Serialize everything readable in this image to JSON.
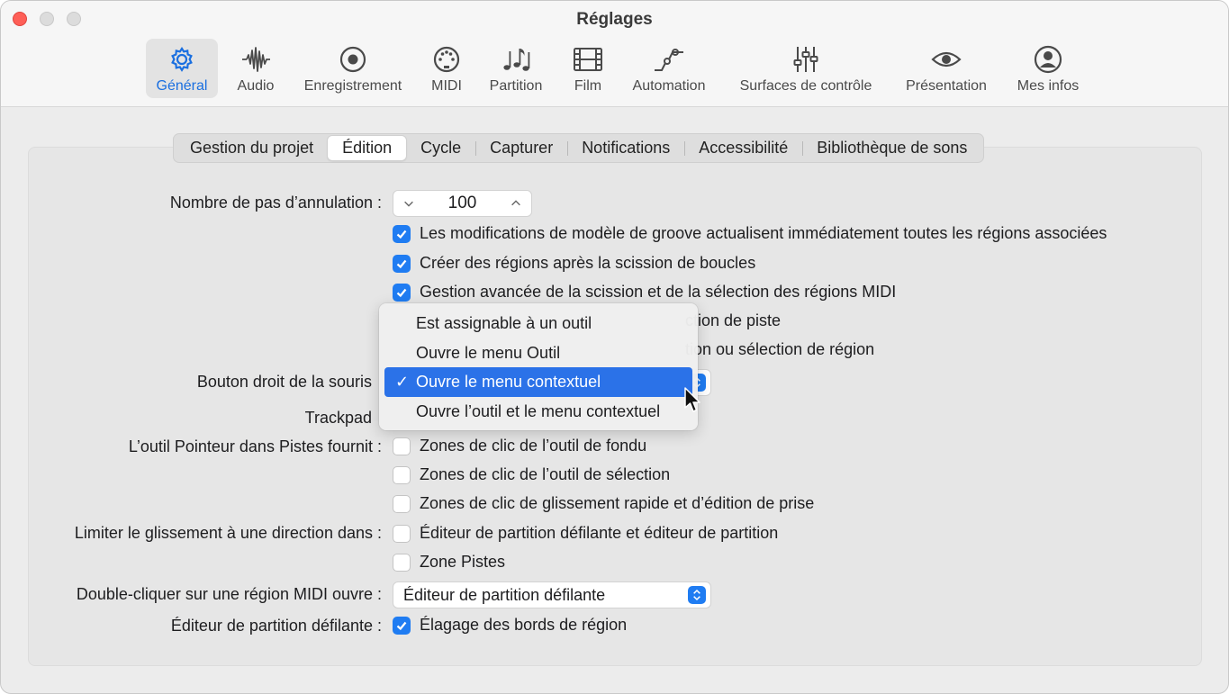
{
  "window": {
    "title": "Réglages"
  },
  "toolbar": {
    "items": [
      {
        "label": "Général",
        "icon": "gear-icon",
        "active": true
      },
      {
        "label": "Audio",
        "icon": "waveform-icon"
      },
      {
        "label": "Enregistrement",
        "icon": "record-icon"
      },
      {
        "label": "MIDI",
        "icon": "midi-port-icon"
      },
      {
        "label": "Partition",
        "icon": "music-notes-icon"
      },
      {
        "label": "Film",
        "icon": "film-icon"
      },
      {
        "label": "Automation",
        "icon": "automation-curve-icon"
      },
      {
        "label": "Surfaces de contrôle",
        "icon": "sliders-icon"
      },
      {
        "label": "Présentation",
        "icon": "eye-icon"
      },
      {
        "label": "Mes infos",
        "icon": "person-icon"
      }
    ]
  },
  "tabs": {
    "items": [
      {
        "label": "Gestion du projet"
      },
      {
        "label": "Édition",
        "active": true
      },
      {
        "label": "Cycle"
      },
      {
        "label": "Capturer"
      },
      {
        "label": "Notifications"
      },
      {
        "label": "Accessibilité"
      },
      {
        "label": "Bibliothèque de sons"
      }
    ]
  },
  "settings": {
    "undo_steps": {
      "label": "Nombre de pas d’annulation :",
      "value": "100"
    },
    "checkboxes_top": [
      {
        "label": "Les modifications de modèle de groove actualisent immédiatement toutes les régions associées",
        "checked": true
      },
      {
        "label": "Créer des régions après la scission de boucles",
        "checked": true
      },
      {
        "label": "Gestion avancée de la scission et de la sélection des régions MIDI",
        "checked": true
      }
    ],
    "partial_rows": [
      {
        "text": "ction de piste"
      },
      {
        "text": "tion ou sélection de région"
      }
    ],
    "right_mouse": {
      "label": "Bouton droit de la souris"
    },
    "trackpad": {
      "label": "Trackpad"
    },
    "context_menu": {
      "items": [
        {
          "label": "Est assignable à un outil",
          "selected": false
        },
        {
          "label": "Ouvre le menu Outil",
          "selected": false
        },
        {
          "label": "Ouvre le menu contextuel",
          "selected": true
        },
        {
          "label": "Ouvre l’outil et le menu contextuel",
          "selected": false
        }
      ],
      "check_glyph": "✓"
    },
    "pointer_tool": {
      "label": "L’outil Pointeur dans Pistes fournit :",
      "options": [
        {
          "label": "Zones de clic de l’outil de fondu",
          "checked": false
        },
        {
          "label": "Zones de clic de l’outil de sélection",
          "checked": false
        },
        {
          "label": "Zones de clic de glissement rapide et d’édition de prise",
          "checked": false
        }
      ]
    },
    "limit_drag": {
      "label": "Limiter le glissement à une direction dans :",
      "options": [
        {
          "label": "Éditeur de partition défilante et éditeur de partition",
          "checked": false
        },
        {
          "label": "Zone Pistes",
          "checked": false
        }
      ]
    },
    "double_click": {
      "label": "Double-cliquer sur une région MIDI ouvre :",
      "value": "Éditeur de partition défilante"
    },
    "piano_roll": {
      "label": "Éditeur de partition défilante :",
      "option": "Élagage des bords de région",
      "checked": true
    }
  },
  "colors": {
    "accent": "#1f7cf2",
    "menu_highlight": "#2b72e8",
    "close": "#fe5f57"
  }
}
